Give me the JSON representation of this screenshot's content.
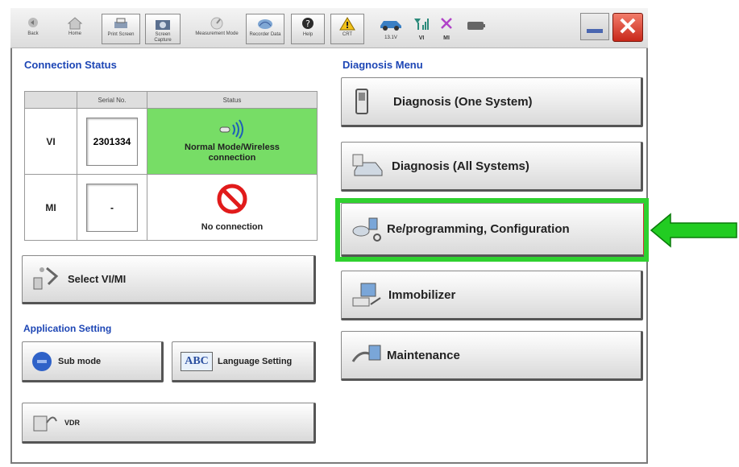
{
  "toolbar": {
    "buttons": [
      {
        "label": "Back"
      },
      {
        "label": "Home"
      },
      {
        "label": "Print Screen"
      },
      {
        "label": "Screen Capture"
      },
      {
        "label": "Measurement Mode"
      },
      {
        "label": "Recorder Data"
      },
      {
        "label": "Help"
      },
      {
        "label": "CRT"
      }
    ],
    "vehicle_voltage": "13.1V",
    "vi_label": "VI",
    "mi_label": "MI"
  },
  "connection_status": {
    "title": "Connection Status",
    "col_serial": "Serial No.",
    "col_status": "Status",
    "rows": [
      {
        "label": "VI",
        "serial": "2301334",
        "status": "Normal Mode/Wireless connection"
      },
      {
        "label": "MI",
        "serial": "-",
        "status": "No connection"
      }
    ]
  },
  "select_vimi_label": "Select VI/MI",
  "application_setting": {
    "title": "Application Setting",
    "sub_mode_label": "Sub mode",
    "language_label": "Language Setting",
    "language_icon_text": "ABC",
    "vdr_label": "VDR"
  },
  "diagnosis_menu": {
    "title": "Diagnosis Menu",
    "items": [
      {
        "label": "Diagnosis (One System)"
      },
      {
        "label": "Diagnosis (All Systems)"
      },
      {
        "label": "Re/programming, Configuration"
      },
      {
        "label": "Immobilizer"
      },
      {
        "label": "Maintenance"
      }
    ]
  },
  "colors": {
    "highlight": "#2fd12f",
    "arrow": "#22cc22",
    "section_title": "#1d46b5",
    "status_ok": "#77dd66",
    "close": "#d9392a"
  }
}
